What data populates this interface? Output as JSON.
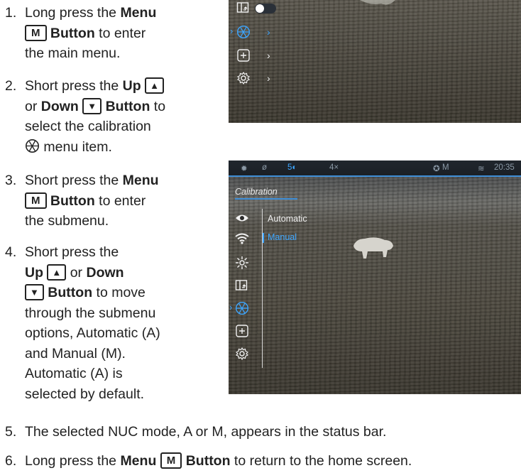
{
  "steps": [
    {
      "num": "1.",
      "lines": [
        {
          "parts": [
            {
              "t": "Long press the "
            },
            {
              "t": "Menu",
              "b": true
            }
          ]
        },
        {
          "parts": [
            {
              "key": "M"
            },
            {
              "t": " "
            },
            {
              "t": "Button",
              "b": true
            },
            {
              "t": " to enter"
            }
          ]
        },
        {
          "parts": [
            {
              "t": "the main menu."
            }
          ]
        }
      ]
    },
    {
      "num": "2.",
      "lines": [
        {
          "parts": [
            {
              "t": "Short press the "
            },
            {
              "t": "Up",
              "b": true
            },
            {
              "t": " "
            },
            {
              "key": "▲"
            }
          ]
        },
        {
          "parts": [
            {
              "t": "or "
            },
            {
              "t": "Down",
              "b": true
            },
            {
              "t": " "
            },
            {
              "key": "▼"
            },
            {
              "t": " "
            },
            {
              "t": "Button",
              "b": true
            },
            {
              "t": " to"
            }
          ]
        },
        {
          "parts": [
            {
              "t": "select the calibration"
            }
          ]
        },
        {
          "parts": [
            {
              "icon": "aperture"
            },
            {
              "t": " menu item."
            }
          ]
        }
      ]
    },
    {
      "num": "3.",
      "lines": [
        {
          "parts": [
            {
              "t": "Short press the "
            },
            {
              "t": "Menu",
              "b": true
            }
          ]
        },
        {
          "parts": [
            {
              "key": "M"
            },
            {
              "t": " "
            },
            {
              "t": "Button",
              "b": true
            },
            {
              "t": " to enter"
            }
          ]
        },
        {
          "parts": [
            {
              "t": "the submenu."
            }
          ]
        }
      ]
    },
    {
      "num": "4.",
      "lines": [
        {
          "parts": [
            {
              "t": "Short press the"
            }
          ]
        },
        {
          "parts": [
            {
              "t": "Up",
              "b": true
            },
            {
              "t": " "
            },
            {
              "key": "▲"
            },
            {
              "t": " or "
            },
            {
              "t": "Down",
              "b": true
            }
          ]
        },
        {
          "parts": [
            {
              "key": "▼"
            },
            {
              "t": " "
            },
            {
              "t": "Button",
              "b": true
            },
            {
              "t": " to move"
            }
          ]
        },
        {
          "parts": [
            {
              "t": "through the submenu"
            }
          ]
        },
        {
          "parts": [
            {
              "t": "options, Automatic (A)"
            }
          ]
        },
        {
          "parts": [
            {
              "t": "and Manual (M)."
            }
          ]
        },
        {
          "parts": [
            {
              "t": "Automatic (A) is"
            }
          ]
        },
        {
          "parts": [
            {
              "t": "selected by default."
            }
          ]
        }
      ]
    },
    {
      "num": "5.",
      "lines": [
        {
          "parts": [
            {
              "t": "The selected NUC mode, A or M, appears in the status bar."
            }
          ]
        }
      ]
    },
    {
      "num": "6.",
      "lines": [
        {
          "parts": [
            {
              "t": "Long press the "
            },
            {
              "t": "Menu",
              "b": true
            },
            {
              "t": " "
            },
            {
              "key": "M"
            },
            {
              "t": " "
            },
            {
              "t": "Button",
              "b": true
            },
            {
              "t": " to return to the home screen."
            }
          ]
        }
      ]
    }
  ],
  "screen2": {
    "statusbar": {
      "zoom": "4×",
      "nuc": "M",
      "time": "20:35"
    },
    "menu_title": "Calibration",
    "options": [
      "Automatic",
      "Manual"
    ]
  },
  "colors": {
    "accent": "#3da6ff",
    "statusbar": "#1c2228"
  }
}
